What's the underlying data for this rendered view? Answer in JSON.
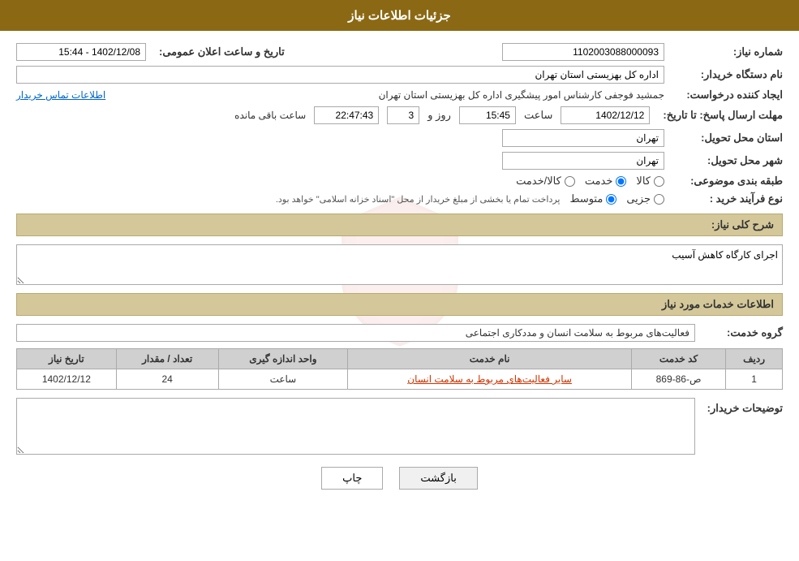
{
  "header": {
    "title": "جزئیات اطلاعات نیاز"
  },
  "fields": {
    "shomara_niaz_label": "شماره نیاز:",
    "shomara_niaz_value": "1102003088000093",
    "nam_dastgah_label": "نام دستگاه خریدار:",
    "nam_dastgah_value": "اداره کل بهزیستی استان تهران",
    "ijad_konande_label": "ایجاد کننده درخواست:",
    "ijad_konande_value": "جمشید فوجفی کارشناس امور پیشگیری اداره کل بهزیستی استان تهران",
    "ettelaat_tamas_label": "اطلاعات تماس خریدار",
    "mohlat_ersal_label": "مهلت ارسال پاسخ: تا تاریخ:",
    "tarikh_value": "1402/12/12",
    "saat_label": "ساعت",
    "saat_value": "15:45",
    "rooz_label": "روز و",
    "rooz_value": "3",
    "baqi_manda_label": "ساعت باقی مانده",
    "baqi_manda_value": "22:47:43",
    "ostan_tahvil_label": "استان محل تحویل:",
    "ostan_tahvil_value": "تهران",
    "shahr_tahvil_label": "شهر محل تحویل:",
    "shahr_tahvil_value": "تهران",
    "tabaqe_bandi_label": "طبقه بندی موضوعی:",
    "tabaqe_options": [
      {
        "label": "کالا",
        "value": "kala"
      },
      {
        "label": "خدمت",
        "value": "khedmat"
      },
      {
        "label": "کالا/خدمت",
        "value": "kala_khedmat"
      }
    ],
    "tabaqe_selected": "khedmat",
    "nooe_farayand_label": "نوع فرآیند خرید :",
    "nooe_farayand_options": [
      {
        "label": "جزیی",
        "value": "jozi"
      },
      {
        "label": "متوسط",
        "value": "motavaset"
      }
    ],
    "nooe_farayand_selected": "motavaset",
    "nooe_farayand_note": "پرداخت تمام یا بخشی از مبلغ خریدار از محل \"اسناد خزانه اسلامی\" خواهد بود.",
    "tarikh_elaan_label": "تاریخ و ساعت اعلان عمومی:",
    "tarikh_elaan_value": "1402/12/08 - 15:44"
  },
  "sharh_section": {
    "title": "شرح کلی نیاز:",
    "value": "اجرای کارگاه کاهش آسیب"
  },
  "khadamat_section": {
    "title": "اطلاعات خدمات مورد نیاز",
    "group_label": "گروه خدمت:",
    "group_value": "فعالیت‌های مربوط به سلامت انسان و مددکاری اجتماعی",
    "table": {
      "headers": [
        "ردیف",
        "کد خدمت",
        "نام خدمت",
        "واحد اندازه گیری",
        "تعداد / مقدار",
        "تاریخ نیاز"
      ],
      "rows": [
        {
          "radif": "1",
          "code": "ص-86-869",
          "name": "سایر فعالیت‌های مربوط به سلامت انسان",
          "unit": "ساعت",
          "count": "24",
          "date": "1402/12/12"
        }
      ]
    }
  },
  "tawsifat_section": {
    "label": "توضیحات خریدار:",
    "value": ""
  },
  "buttons": {
    "print_label": "چاپ",
    "back_label": "بازگشت"
  }
}
